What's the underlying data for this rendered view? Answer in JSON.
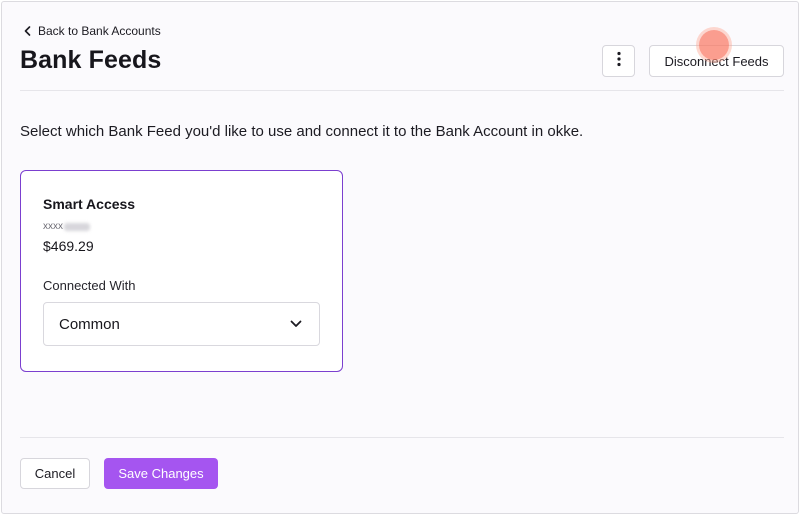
{
  "header": {
    "back_label": "Back to Bank Accounts",
    "title": "Bank Feeds",
    "more_icon": "vertical-ellipsis-icon",
    "disconnect_label": "Disconnect Feeds"
  },
  "main": {
    "intro": "Select which Bank Feed you'd like to use and connect it to the Bank Account in okke.",
    "feed": {
      "name": "Smart Access",
      "account_prefix": "xxxx",
      "balance": "$469.29",
      "connected_label": "Connected With",
      "connected_value": "Common"
    }
  },
  "footer": {
    "cancel_label": "Cancel",
    "save_label": "Save Changes"
  },
  "colors": {
    "accent": "#a555f0",
    "card_border": "#7b3fcf",
    "background": "#fbfafd"
  }
}
